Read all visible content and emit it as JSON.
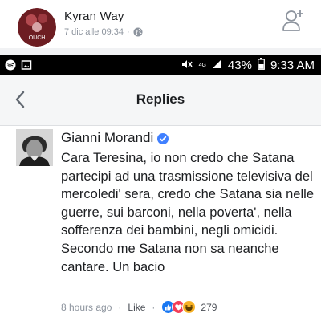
{
  "post": {
    "author": "Kyran Way",
    "avatar_text": "OUCH",
    "timestamp": "7 dic alle 09:34",
    "separator": "·"
  },
  "status_bar": {
    "network": "4G",
    "battery": "43%",
    "time": "9:33 AM"
  },
  "replies_header": {
    "title": "Replies"
  },
  "comment": {
    "author": "Gianni Morandi",
    "text": "Cara Teresina, io non credo che Satana partecipi ad una trasmissione televisiva del mercoledi' sera, credo che Satana sia nelle guerre, sui barconi, nella poverta', nella sofferenza dei bambini, negli omicidi. Secondo me Satana non sa neanche cantare. Un bacio",
    "time_ago": "8 hours ago",
    "like_label": "Like",
    "separator": "·",
    "reaction_count": "279",
    "reactions": [
      "like",
      "love",
      "haha"
    ]
  },
  "colors": {
    "like_blue": "#1877f2",
    "love_red": "#f33e58",
    "haha_yellow": "#f7b125",
    "verified_blue": "#4080ff"
  }
}
